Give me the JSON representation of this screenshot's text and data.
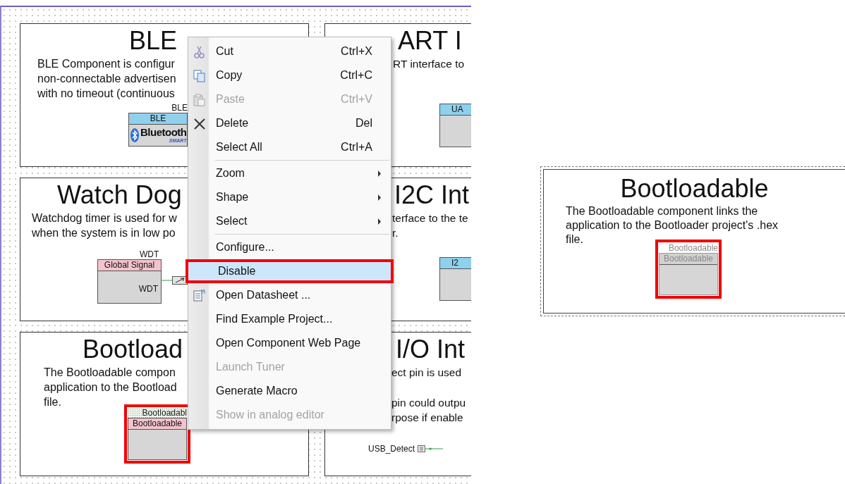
{
  "canvas": {
    "cards": [
      {
        "title": "BLE",
        "description": [
          "BLE Component is configur\nnon-connectable advertisen\nwith no timeout (continuous"
        ],
        "component": {
          "kind": "ble",
          "label": "BLE",
          "header": "BLE",
          "logo_text": "Bluetooth",
          "logo_subtext": "SMART"
        }
      },
      {
        "title": "ART I",
        "description": [
          "RT interface to"
        ],
        "component": {
          "kind": "stub",
          "header": "UA"
        }
      },
      {
        "title": "Watch Dog",
        "description": [
          "Watchdog timer is used for w\nwhen the system is in low po"
        ],
        "component": {
          "kind": "signal",
          "label": "WDT",
          "header": "Global Signal",
          "terminal": "WDT"
        }
      },
      {
        "title": "I2C Int",
        "description": [
          "terface to the te\nr."
        ],
        "component": {
          "kind": "stub",
          "header": "I2"
        }
      },
      {
        "title": "Bootload",
        "description": [
          "The Bootloadable compon\napplication to the Bootload\nfile."
        ],
        "component": {
          "kind": "bootloadable",
          "label": "Bootloadabl",
          "header": "Bootloadable",
          "disabled": false,
          "annotated": true
        }
      },
      {
        "title": "I/O Int",
        "description": [
          "ect pin is used",
          "pin could outpu\nrpose if enable"
        ],
        "component": {
          "kind": "pin",
          "label": "USB_Detect"
        }
      }
    ]
  },
  "context_menu": {
    "items": [
      {
        "kind": "command",
        "label": "Cut",
        "shortcut": "Ctrl+X",
        "disabled": false,
        "selected": false,
        "annotated": false
      },
      {
        "kind": "command",
        "label": "Copy",
        "shortcut": "Ctrl+C",
        "disabled": false,
        "selected": false,
        "annotated": false
      },
      {
        "kind": "command",
        "label": "Paste",
        "shortcut": "Ctrl+V",
        "disabled": true,
        "selected": false,
        "annotated": false
      },
      {
        "kind": "command",
        "label": "Delete",
        "shortcut": "Del",
        "disabled": false,
        "selected": false,
        "annotated": false
      },
      {
        "kind": "command",
        "label": "Select All",
        "shortcut": "Ctrl+A",
        "disabled": false,
        "selected": false,
        "annotated": false
      },
      {
        "kind": "separator"
      },
      {
        "kind": "submenu",
        "label": "Zoom",
        "disabled": false,
        "selected": false,
        "annotated": false
      },
      {
        "kind": "submenu",
        "label": "Shape",
        "disabled": false,
        "selected": false,
        "annotated": false
      },
      {
        "kind": "submenu",
        "label": "Select",
        "disabled": false,
        "selected": false,
        "annotated": false
      },
      {
        "kind": "separator"
      },
      {
        "kind": "command",
        "label": "Configure...",
        "disabled": false,
        "selected": false,
        "annotated": false
      },
      {
        "kind": "command",
        "label": "Disable",
        "disabled": false,
        "selected": true,
        "annotated": true
      },
      {
        "kind": "command",
        "label": "Open Datasheet ...",
        "disabled": false,
        "selected": false,
        "annotated": false
      },
      {
        "kind": "command",
        "label": "Find Example Project...",
        "disabled": false,
        "selected": false,
        "annotated": false
      },
      {
        "kind": "command",
        "label": "Open Component Web Page",
        "disabled": false,
        "selected": false,
        "annotated": false
      },
      {
        "kind": "command",
        "label": "Launch Tuner",
        "disabled": true,
        "selected": false,
        "annotated": false
      },
      {
        "kind": "command",
        "label": "Generate Macro",
        "disabled": false,
        "selected": false,
        "annotated": false
      },
      {
        "kind": "command",
        "label": "Show in analog editor",
        "disabled": true,
        "selected": false,
        "annotated": false
      }
    ]
  },
  "preview_panel": {
    "title": "Bootloadable",
    "description": [
      "The Bootloadable component links the\napplication to the Bootloader project's .hex\nfile."
    ],
    "component": {
      "kind": "bootloadable",
      "label": "Bootloadable",
      "header": "Bootloadable",
      "disabled": true,
      "annotated": true
    }
  }
}
